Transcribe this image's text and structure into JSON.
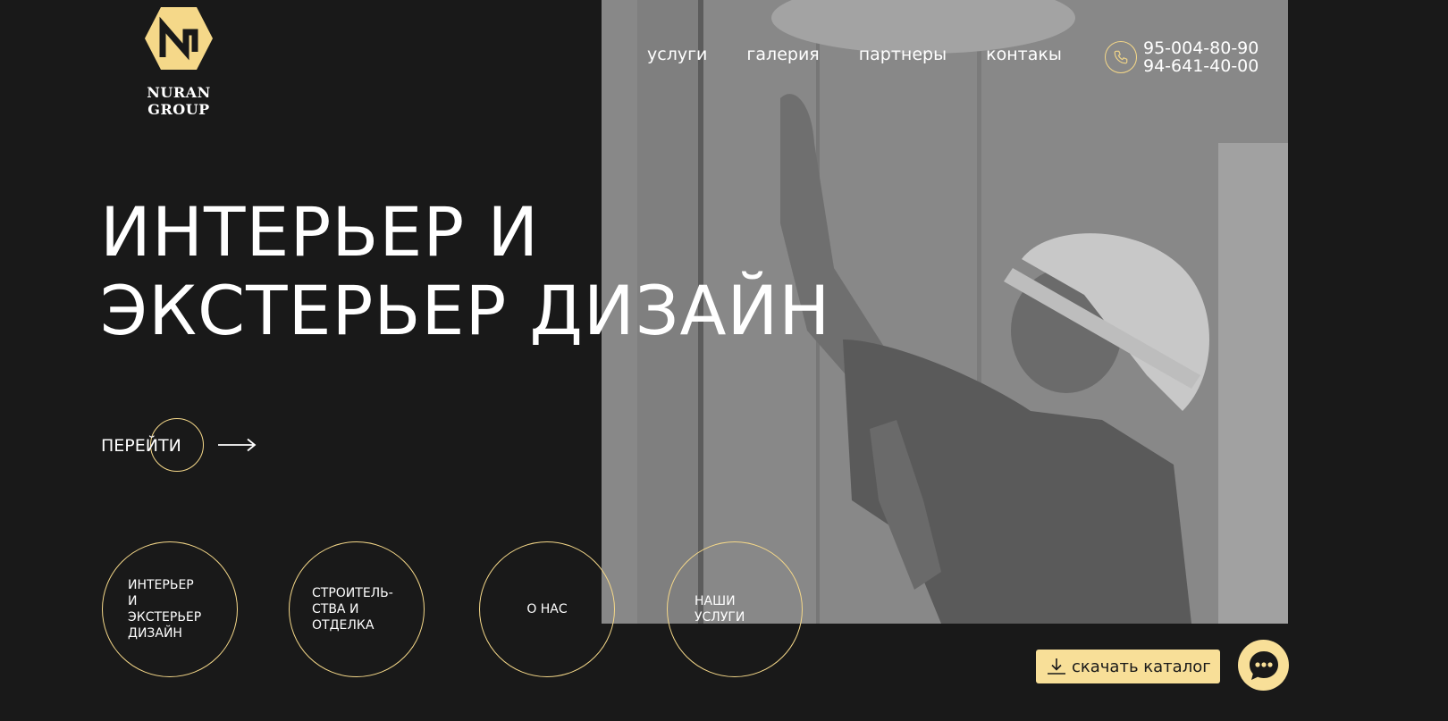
{
  "brand": {
    "name": "NURAN GROUP",
    "accent_color": "#f5d889",
    "background_color": "#191919"
  },
  "nav": {
    "items": [
      {
        "label": "услуги"
      },
      {
        "label": "галерия"
      },
      {
        "label": "партнеры"
      },
      {
        "label": "контакы"
      }
    ]
  },
  "contact": {
    "phones": [
      "95-004-80-90",
      "94-641-40-00"
    ],
    "icon": "phone-icon"
  },
  "hero": {
    "headline_lines": [
      "ИНТЕРЬЕР И",
      "ЭКСТЕРЬЕР ДИЗАЙН"
    ],
    "cta_label": "ПЕРЕЙТИ",
    "cta_icon": "arrow-right-icon",
    "image": "worker-in-hard-hat-photo"
  },
  "sections": [
    {
      "label": "ИНТЕРЬЕР\nИ\nЭКСТЕРЬЕР\nДИЗАЙН"
    },
    {
      "label": "СТРОИТЕЛЬ-\nСТВА И\nОТДЕЛКА"
    },
    {
      "label": "О НАС"
    },
    {
      "label": "НАШИ\nУСЛУГИ"
    }
  ],
  "catalog": {
    "label": "скачать каталог",
    "icon": "download-icon"
  },
  "chat": {
    "icon": "chat-bubble-icon"
  }
}
